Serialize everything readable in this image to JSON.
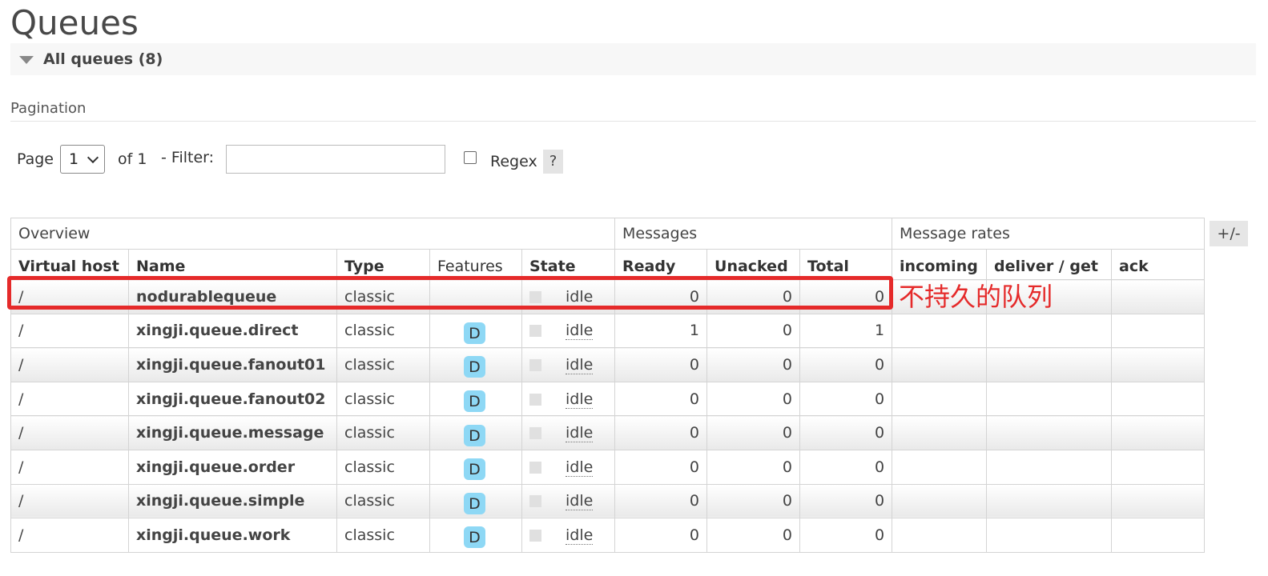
{
  "page_title": "Queues",
  "section": {
    "label": "All queues (8)"
  },
  "pagination": {
    "title": "Pagination",
    "page_label": "Page",
    "page_value": "1",
    "of_label": "of 1",
    "filter_label": "- Filter:",
    "filter_value": "",
    "regex_label": "Regex",
    "help_label": "?"
  },
  "toggle_columns_label": "+/-",
  "table": {
    "groups": [
      "Overview",
      "Messages",
      "Message rates"
    ],
    "columns": [
      "Virtual host",
      "Name",
      "Type",
      "Features",
      "State",
      "Ready",
      "Unacked",
      "Total",
      "incoming",
      "deliver / get",
      "ack"
    ],
    "rows": [
      {
        "vhost": "/",
        "name": "nodurablequeue",
        "type": "classic",
        "feature": "",
        "state": "idle",
        "ready": "0",
        "unacked": "0",
        "total": "0"
      },
      {
        "vhost": "/",
        "name": "xingji.queue.direct",
        "type": "classic",
        "feature": "D",
        "state": "idle",
        "ready": "1",
        "unacked": "0",
        "total": "1"
      },
      {
        "vhost": "/",
        "name": "xingji.queue.fanout01",
        "type": "classic",
        "feature": "D",
        "state": "idle",
        "ready": "0",
        "unacked": "0",
        "total": "0"
      },
      {
        "vhost": "/",
        "name": "xingji.queue.fanout02",
        "type": "classic",
        "feature": "D",
        "state": "idle",
        "ready": "0",
        "unacked": "0",
        "total": "0"
      },
      {
        "vhost": "/",
        "name": "xingji.queue.message",
        "type": "classic",
        "feature": "D",
        "state": "idle",
        "ready": "0",
        "unacked": "0",
        "total": "0"
      },
      {
        "vhost": "/",
        "name": "xingji.queue.order",
        "type": "classic",
        "feature": "D",
        "state": "idle",
        "ready": "0",
        "unacked": "0",
        "total": "0"
      },
      {
        "vhost": "/",
        "name": "xingji.queue.simple",
        "type": "classic",
        "feature": "D",
        "state": "idle",
        "ready": "0",
        "unacked": "0",
        "total": "0"
      },
      {
        "vhost": "/",
        "name": "xingji.queue.work",
        "type": "classic",
        "feature": "D",
        "state": "idle",
        "ready": "0",
        "unacked": "0",
        "total": "0"
      }
    ]
  },
  "annotation": {
    "text": "不持久的队列",
    "color": "#e52a2a"
  },
  "colors": {
    "badge": "#8ed8f5",
    "annotation": "#e52a2a"
  }
}
